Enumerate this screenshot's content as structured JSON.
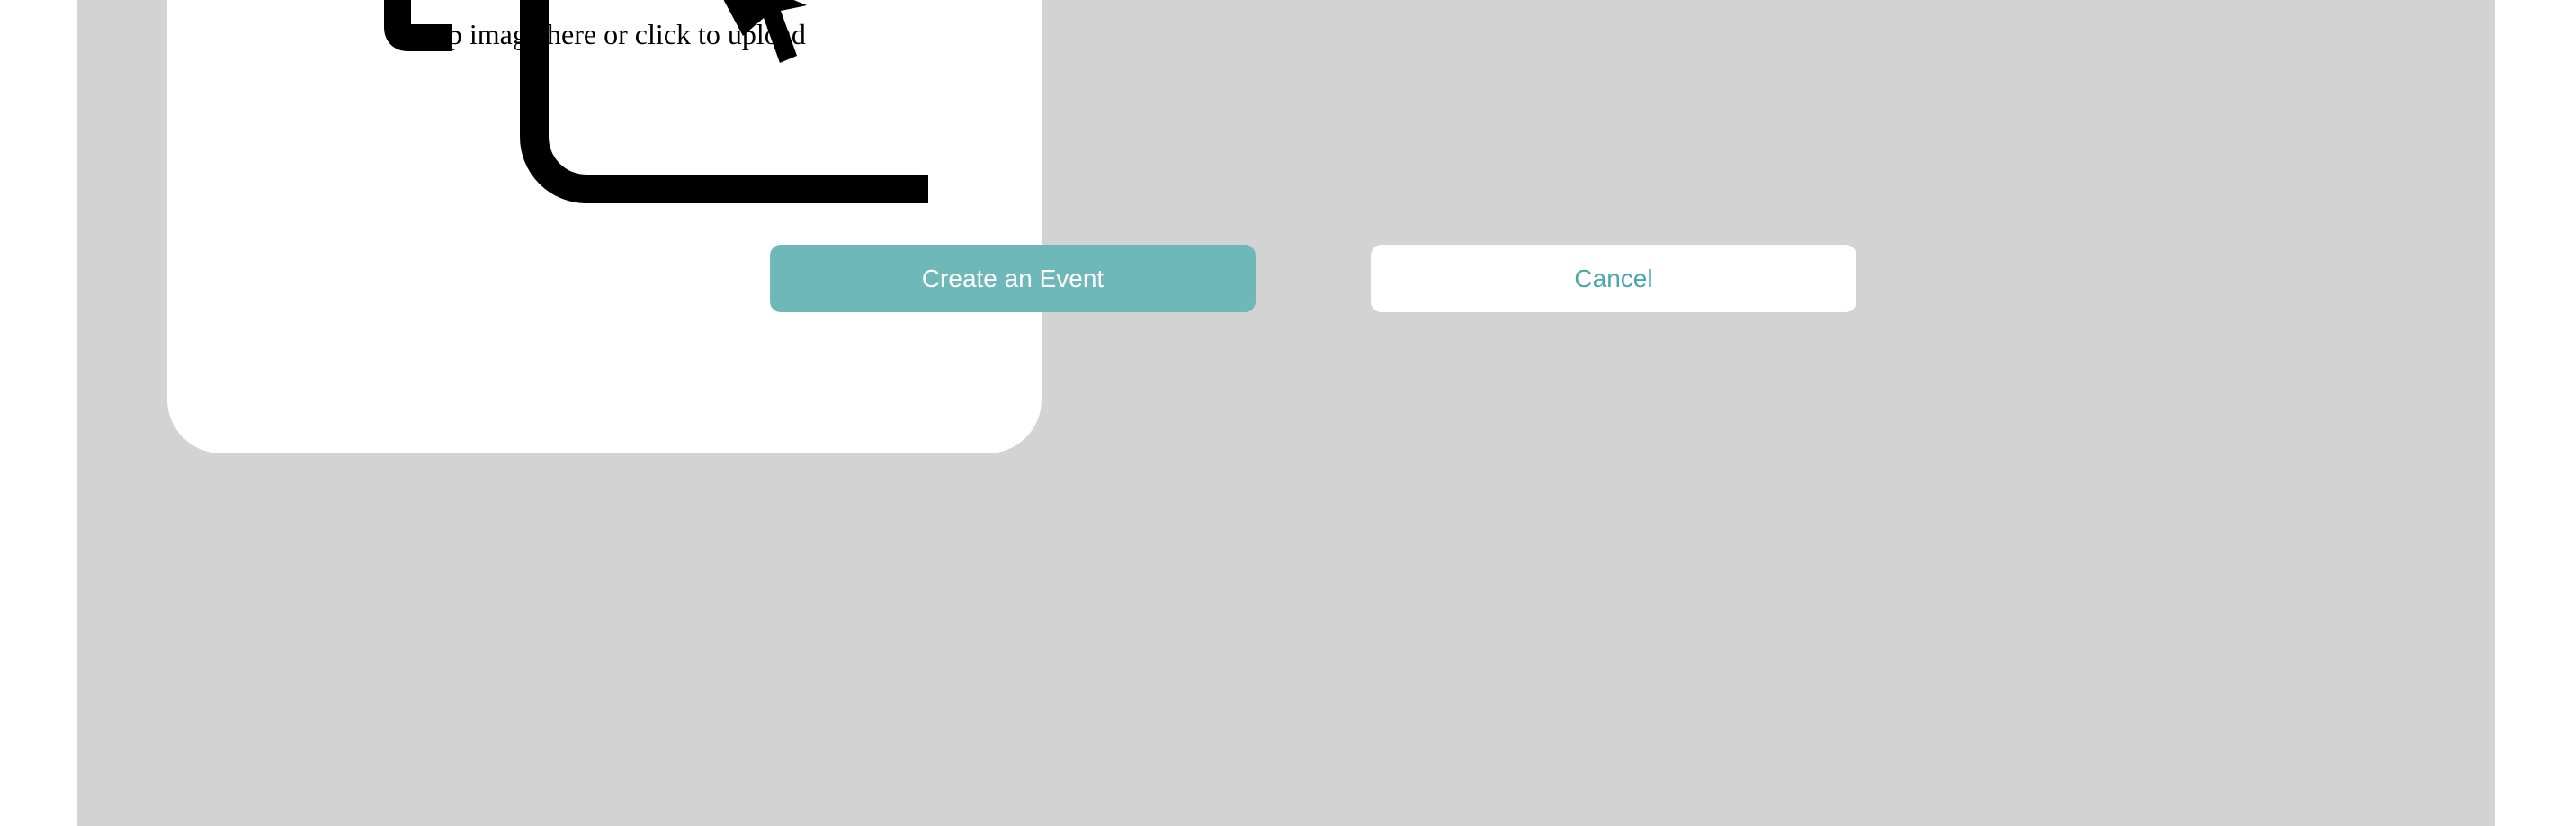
{
  "dropzone": {
    "text": "Drop image here or click to upload",
    "icon": "upload-image-icon"
  },
  "actions": {
    "create_label": "Create an Event",
    "cancel_label": "Cancel"
  },
  "colors": {
    "panel_bg": "#d3d3d3",
    "primary": "#6fb8ba",
    "secondary_text": "#4aa8ad"
  }
}
